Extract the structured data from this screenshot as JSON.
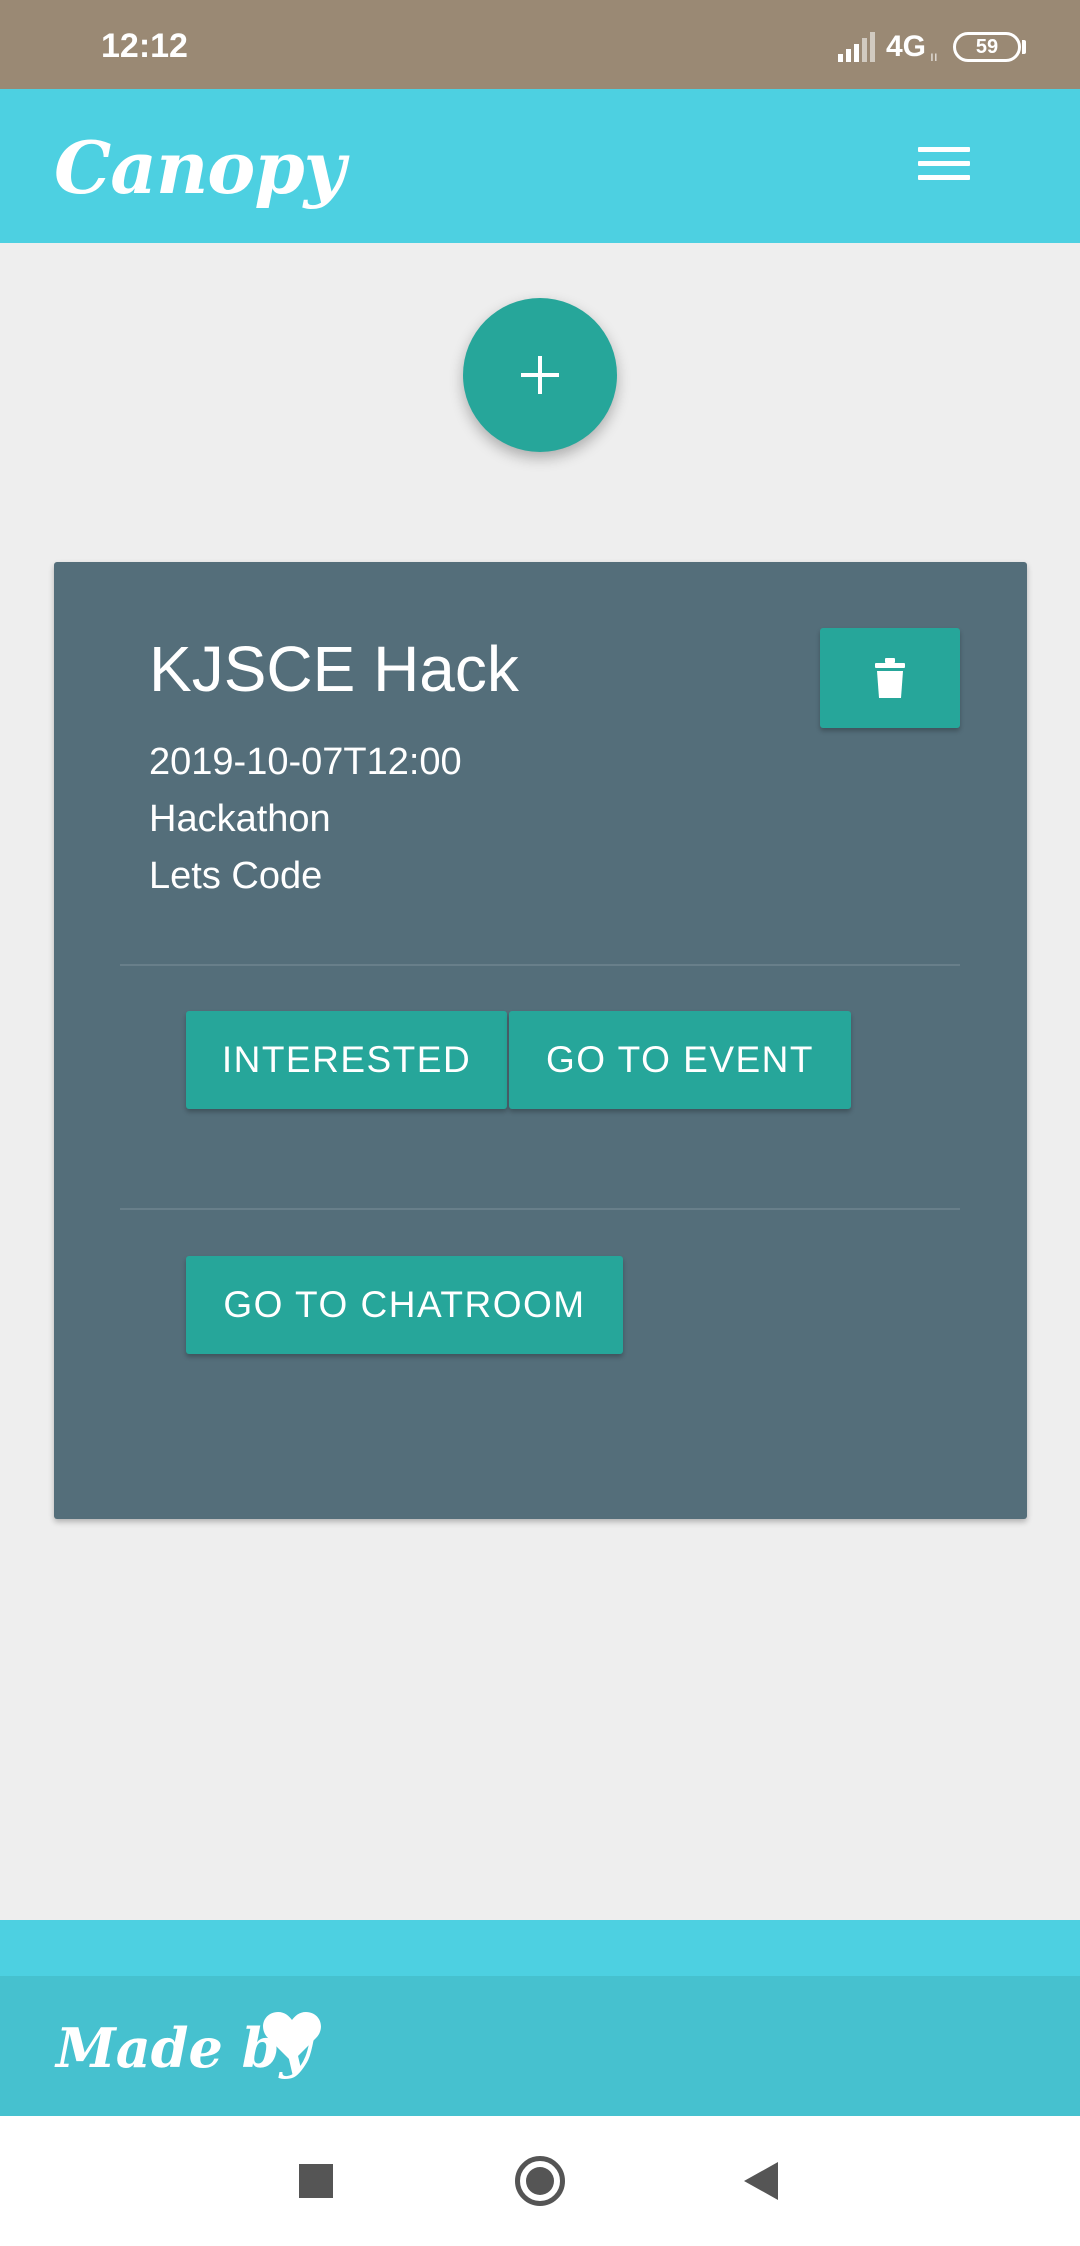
{
  "status_bar": {
    "time": "12:12",
    "network": "4G",
    "network_sub": "ıı",
    "battery": "59"
  },
  "header": {
    "logo": "Canopy",
    "menu_icon": "hamburger-menu-icon"
  },
  "fab": {
    "icon": "plus-icon",
    "color": "#26a69a"
  },
  "event_card": {
    "title": "KJSCE Hack",
    "datetime": "2019-10-07T12:00",
    "category": "Hackathon",
    "description": "Lets Code",
    "delete_icon": "trash-icon",
    "buttons": {
      "interested": "INTERESTED",
      "go_to_event": "GO TO EVENT",
      "go_to_chatroom": "GO TO CHATROOM"
    }
  },
  "footer": {
    "text": "Made by",
    "icon": "heart-icon"
  },
  "nav_bar": {
    "recents_icon": "recents-icon",
    "home_icon": "home-icon",
    "back_icon": "back-icon"
  },
  "colors": {
    "accent": "#26a69a",
    "header": "#4dd0e1",
    "card": "#546e7a",
    "status_bar": "#9a8974",
    "background": "#eeeeee"
  }
}
